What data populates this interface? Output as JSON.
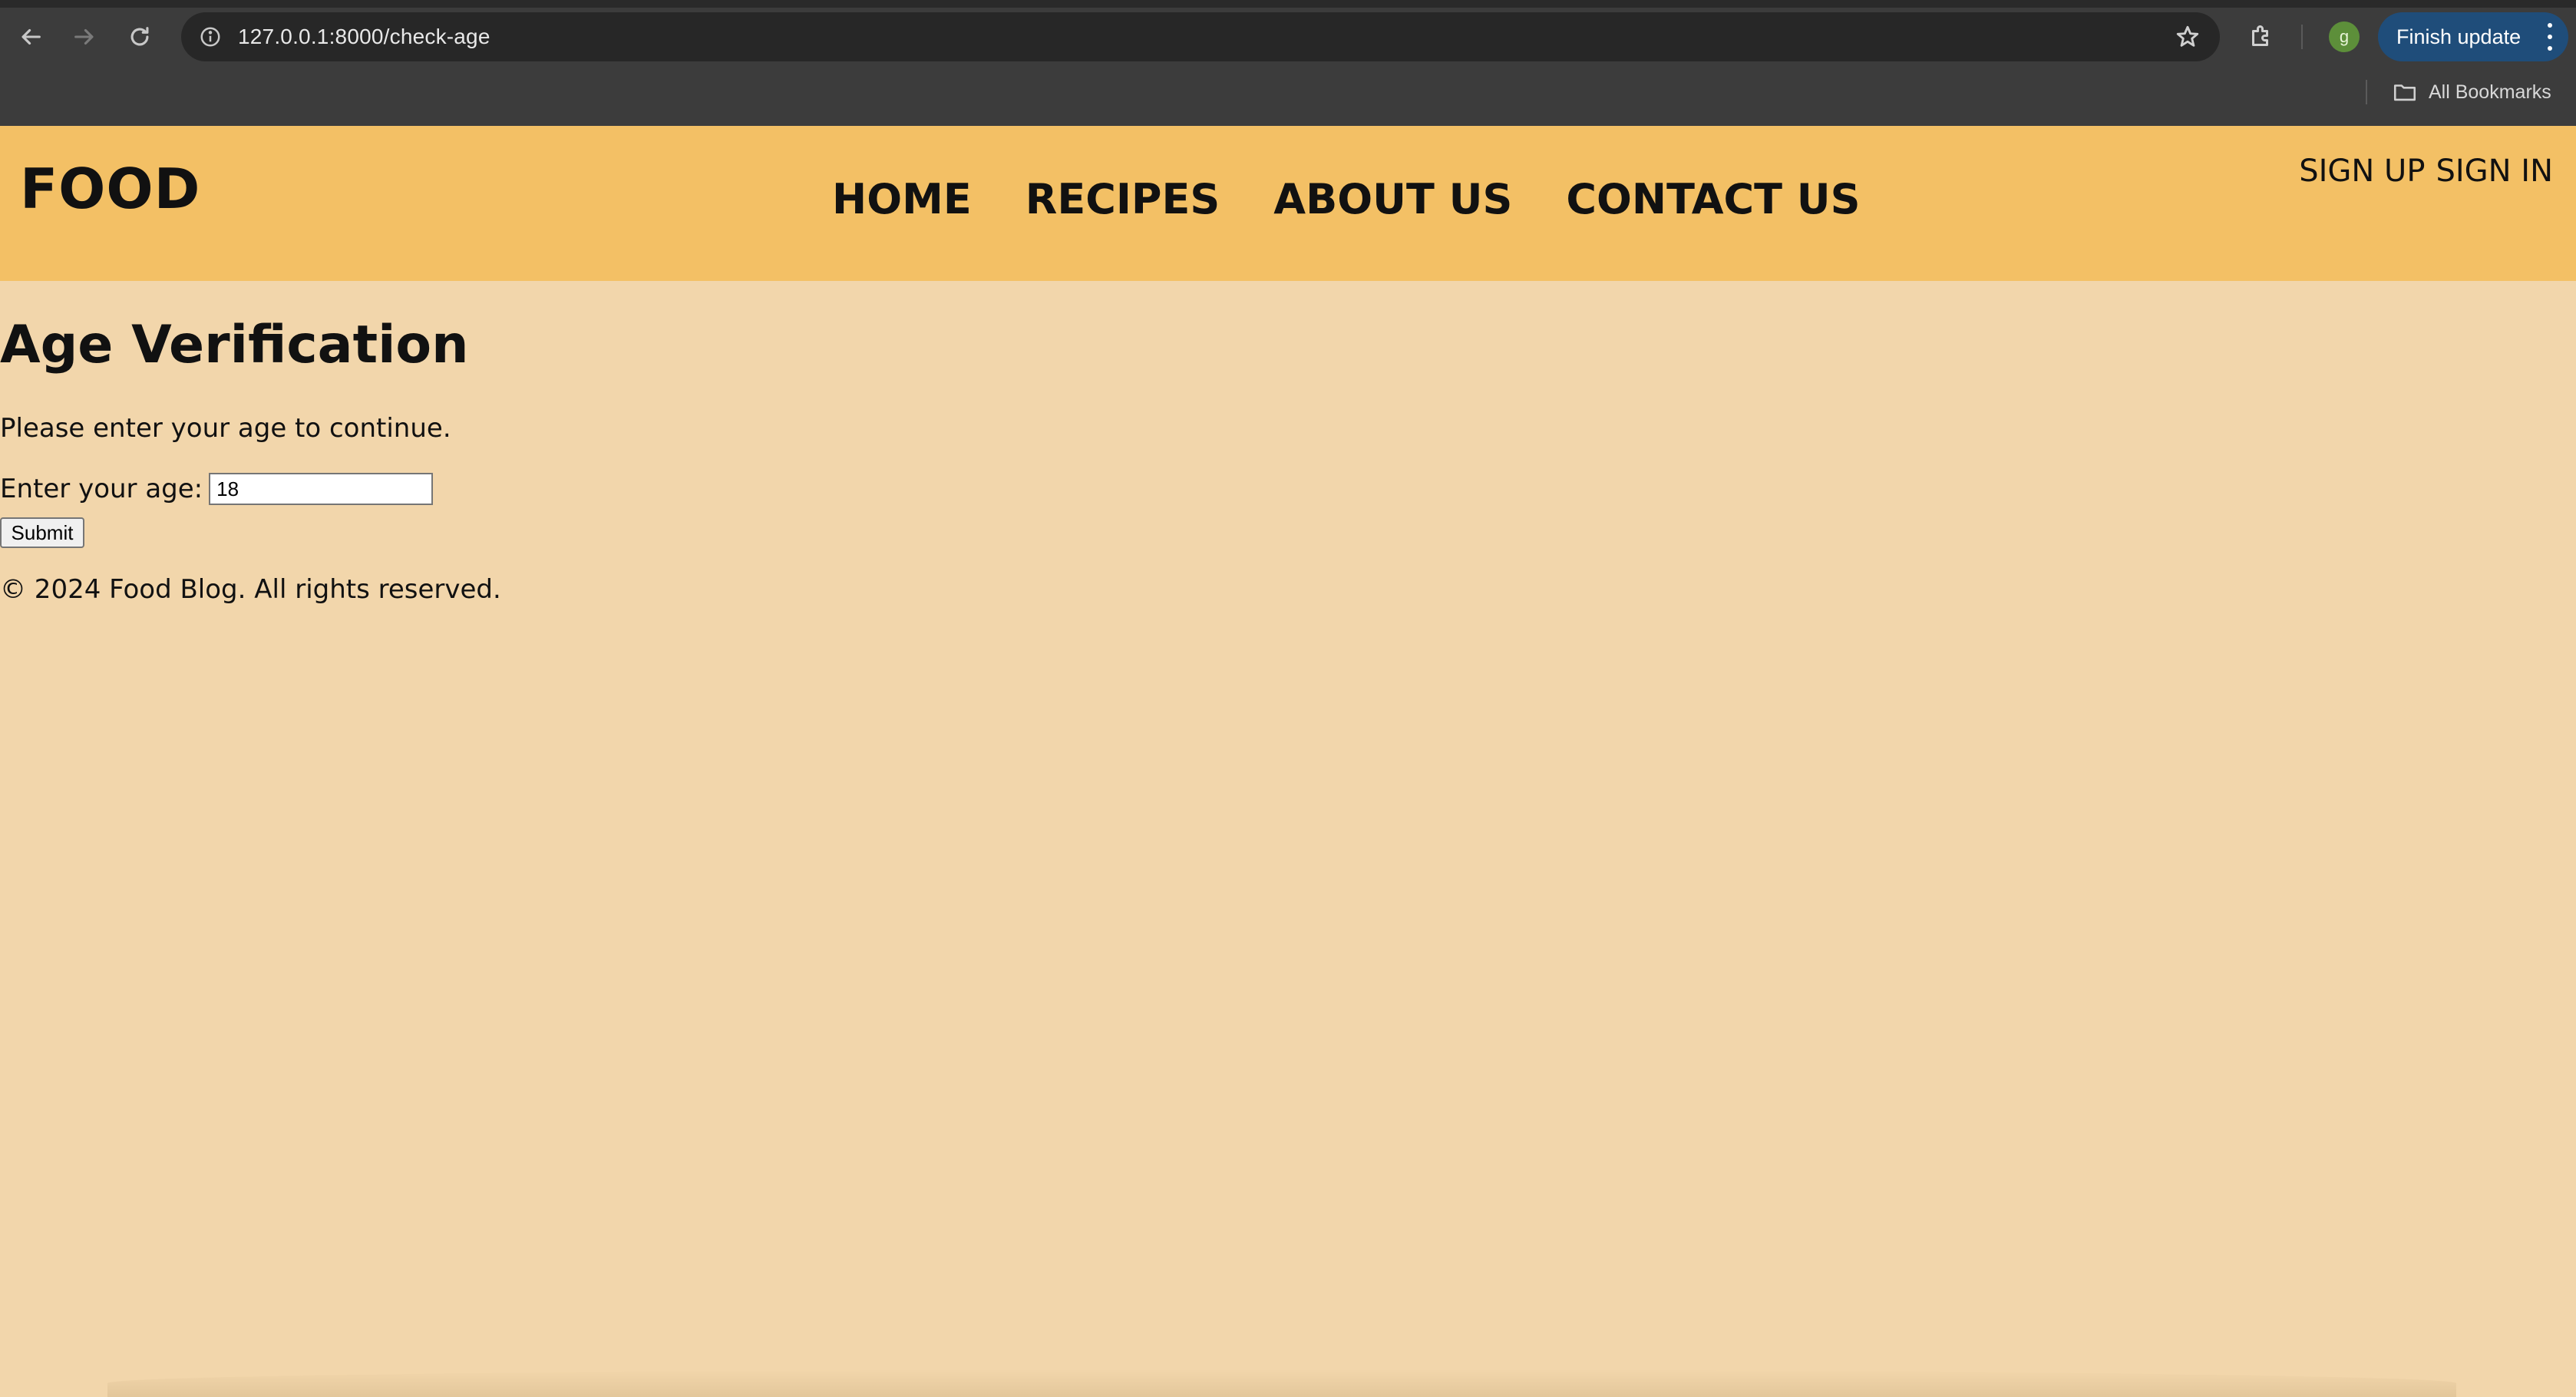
{
  "browser": {
    "url": "127.0.0.1:8000/check-age",
    "profile_initial": "g",
    "finish_update_label": "Finish update",
    "bookmarks_label": "All Bookmarks",
    "icons": {
      "back": "arrow-left-icon",
      "forward": "arrow-right-icon",
      "reload": "reload-icon",
      "site_info": "info-icon",
      "bookmark_star": "star-icon",
      "extensions": "puzzle-icon",
      "menu": "kebab-menu-icon",
      "bookmarks_folder": "folder-icon"
    },
    "colors": {
      "chrome_bg": "#3c3c3c",
      "omnibox_bg": "#272727",
      "finish_update_bg": "#1f4d7a",
      "profile_bg": "#5d8f3a"
    }
  },
  "site": {
    "logo": "FOOD",
    "nav": [
      "HOME",
      "RECIPES",
      "ABOUT US",
      "CONTACT US"
    ],
    "auth": {
      "sign_up": "SIGN UP",
      "sign_in": "SIGN IN"
    },
    "colors": {
      "header_bg": "#f3c065",
      "page_bg": "#f2d6ab",
      "text": "#111111"
    }
  },
  "content": {
    "title": "Age Verification",
    "intro": "Please enter your age to continue.",
    "age_label": "Enter your age:",
    "age_value": "18",
    "submit_label": "Submit",
    "footer": "© 2024 Food Blog. All rights reserved."
  }
}
